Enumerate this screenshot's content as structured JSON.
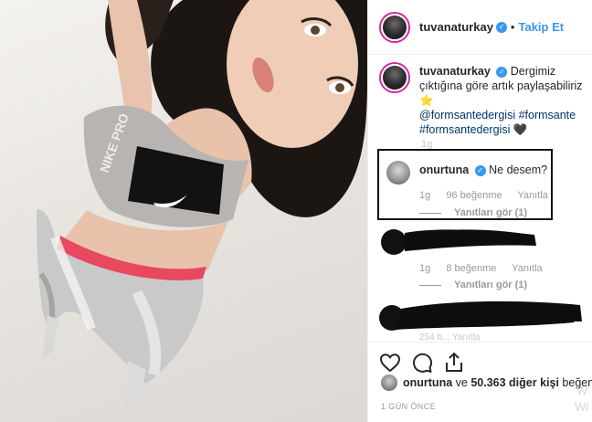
{
  "header": {
    "username": "tuvanaturkay",
    "separator": "•",
    "follow_label": "Takip Et"
  },
  "caption": {
    "username": "tuvanaturkay",
    "text": "Dergimiz çıktığına göre artık paylaşabiliriz",
    "emoji": "⭐",
    "tag1": "@formsantedergisi",
    "tag2": "#formsante",
    "tag3": "#formsantedergisi",
    "heart": "🖤",
    "time": "1g"
  },
  "highlighted_comment": {
    "username": "onurtuna",
    "text": "Ne desem?",
    "time": "1g",
    "likes": "96 beğenme",
    "reply_label": "Yanıtla",
    "view_replies": "Yanıtları gör (1)"
  },
  "redacted_comment_1": {
    "time": "1g",
    "likes": "8 beğenme",
    "reply_label": "Yanıtla",
    "view_replies": "Yanıtları gör (1)"
  },
  "redacted_comment_2": {
    "faded_text": "254 b... Yanıtla"
  },
  "actions": {
    "like_icon": "heart-outline-icon",
    "comment_icon": "speech-bubble-icon",
    "share_icon": "share-upload-icon"
  },
  "likes_line": {
    "first_user": "onurtuna",
    "connector": "ve",
    "others": "50.363 diğer kişi",
    "suffix": "beğendi"
  },
  "timestamp": "1 GÜN ÖNCE",
  "watermark": {
    "line1": "W",
    "line2": "Wi"
  },
  "photo": {
    "brand_text": "NIKE PRO"
  },
  "colors": {
    "link_blue": "#3897f0",
    "verified_blue": "#3897f0",
    "hashtag": "#003569",
    "meta_gray": "#999999"
  }
}
